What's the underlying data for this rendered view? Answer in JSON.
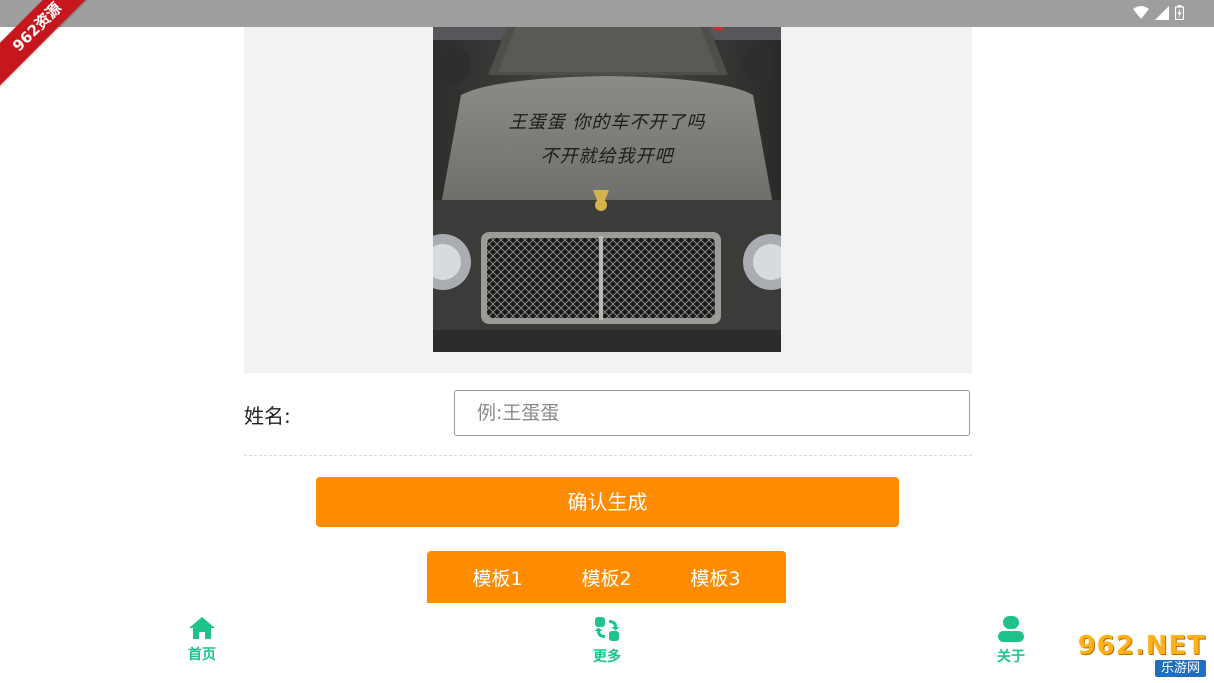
{
  "watermark": {
    "corner": "962资源",
    "site_top": "962.NET",
    "site_bottom": "乐游网"
  },
  "status_bar": {
    "icons": [
      "wifi-icon",
      "signal-icon",
      "battery-icon"
    ]
  },
  "image": {
    "hood_line_1": "王蛋蛋 你的车不开了吗",
    "hood_line_2": "不开就给我开吧"
  },
  "form": {
    "name_label": "姓名:",
    "name_placeholder": "例:王蛋蛋",
    "name_value": "",
    "confirm_label": "确认生成"
  },
  "templates": [
    {
      "label": "模板1"
    },
    {
      "label": "模板2"
    },
    {
      "label": "模板3"
    }
  ],
  "nav": [
    {
      "label": "首页",
      "icon": "home-icon"
    },
    {
      "label": "更多",
      "icon": "refresh-swap-icon"
    },
    {
      "label": "关于",
      "icon": "user-icon"
    }
  ],
  "colors": {
    "accent": "#ff8c00",
    "nav": "#1ec28b",
    "status_bar": "#9e9e9e"
  }
}
